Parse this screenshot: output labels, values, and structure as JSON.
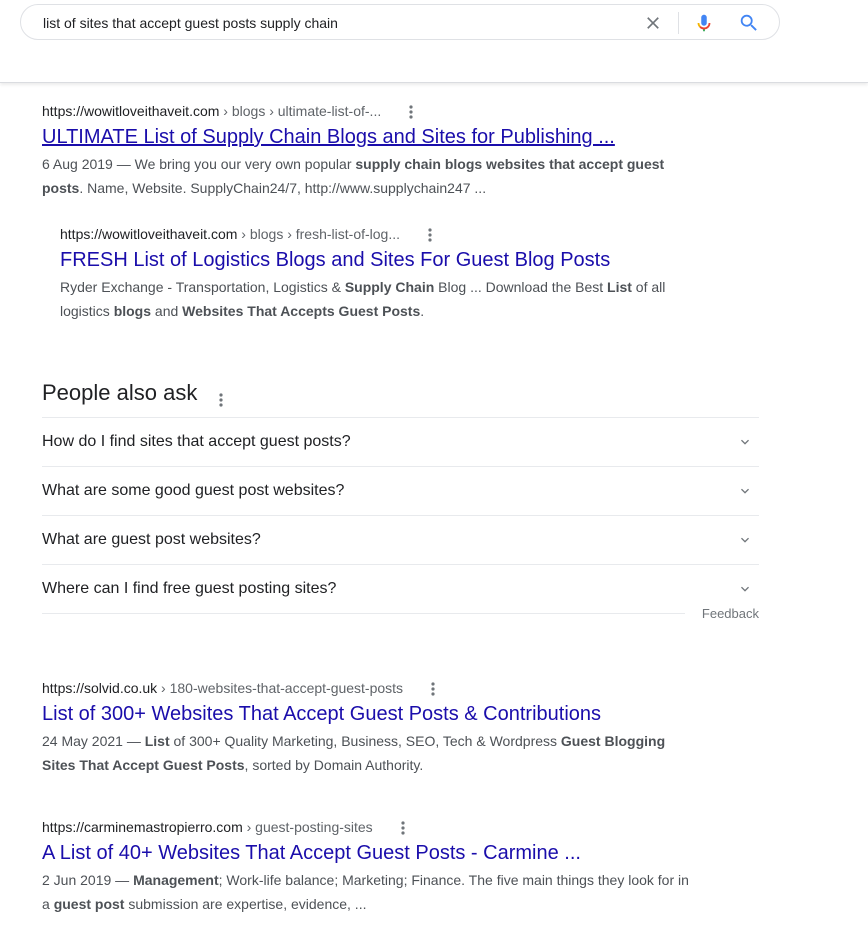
{
  "search": {
    "query": "list of sites that accept guest posts supply chain",
    "icons": {
      "clear": "close-icon",
      "voice": "microphone-icon",
      "submit": "search-icon"
    }
  },
  "results_top": [
    {
      "domain": "https://wowitloveithaveit.com",
      "path": " › blogs › ultimate-list-of-...",
      "title": "ULTIMATE List of Supply Chain Blogs and Sites for Publishing ...",
      "snippet_parts": [
        {
          "t": "6 Aug 2019 — We bring you our very own popular ",
          "b": false
        },
        {
          "t": "supply chain blogs websites that accept guest posts",
          "b": true
        },
        {
          "t": ". Name, Website. SupplyChain24/7, http://www.supplychain247 ...",
          "b": false
        }
      ]
    },
    {
      "domain": "https://wowitloveithaveit.com",
      "path": " › blogs › fresh-list-of-log...",
      "title": "FRESH List of Logistics Blogs and Sites For Guest Blog Posts",
      "snippet_parts": [
        {
          "t": "Ryder Exchange - Transportation, Logistics & ",
          "b": false
        },
        {
          "t": "Supply Chain",
          "b": true
        },
        {
          "t": " Blog ... Download the Best ",
          "b": false
        },
        {
          "t": "List",
          "b": true
        },
        {
          "t": " of all logistics ",
          "b": false
        },
        {
          "t": "blogs",
          "b": true
        },
        {
          "t": " and ",
          "b": false
        },
        {
          "t": "Websites That Accepts Guest Posts",
          "b": true
        },
        {
          "t": ".",
          "b": false
        }
      ]
    }
  ],
  "people_also_ask": {
    "heading": "People also ask",
    "questions": [
      "How do I find sites that accept guest posts?",
      "What are some good guest post websites?",
      "What are guest post websites?",
      "Where can I find free guest posting sites?"
    ],
    "feedback_label": "Feedback"
  },
  "results_bottom": [
    {
      "domain": "https://solvid.co.uk",
      "path": " › 180-websites-that-accept-guest-posts",
      "title": "List of 300+ Websites That Accept Guest Posts & Contributions",
      "snippet_parts": [
        {
          "t": "24 May 2021 — ",
          "b": false
        },
        {
          "t": "List",
          "b": true
        },
        {
          "t": " of 300+ Quality Marketing, Business, SEO, Tech & Wordpress ",
          "b": false
        },
        {
          "t": "Guest Blogging Sites That Accept Guest Posts",
          "b": true
        },
        {
          "t": ", sorted by Domain Authority.",
          "b": false
        }
      ]
    },
    {
      "domain": "https://carminemastropierro.com",
      "path": " › guest-posting-sites",
      "title": "A List of 40+ Websites That Accept Guest Posts - Carmine ...",
      "snippet_parts": [
        {
          "t": "2 Jun 2019 — ",
          "b": false
        },
        {
          "t": "Management",
          "b": true
        },
        {
          "t": "; Work-life balance; Marketing; Finance. The five main things they look for in a ",
          "b": false
        },
        {
          "t": "guest post",
          "b": true
        },
        {
          "t": " submission are expertise, evidence, ...",
          "b": false
        }
      ]
    }
  ]
}
